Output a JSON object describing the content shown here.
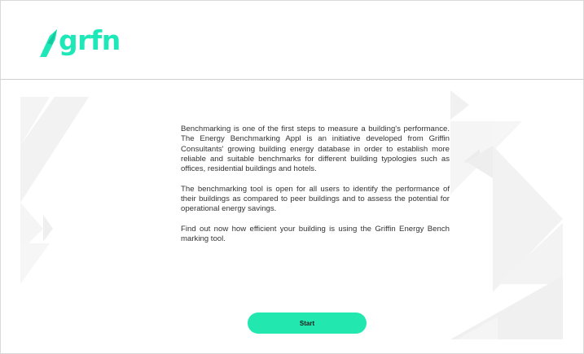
{
  "brand": {
    "logo_text": "grfn",
    "logo_icon": "grfn-arrow-mark",
    "accent_color": "#1ee8b8"
  },
  "intro": {
    "paragraphs": [
      "Benchmarking is one of the first steps to measure a building's performance. The Energy Benchmarking Appl is an initiative developed from Griffin Consultants' growing building energy database in order to establish more reliable and suitable benchmarks for different building typologies such as offices, residential buildings and hotels.",
      "The benchmarking tool is open for all users to identify the performance of their buildings as compared to peer buildings and to assess the potential for operational energy savings.",
      "Find out now how efficient your building is using the Griffin Energy Bench marking tool."
    ]
  },
  "actions": {
    "start_label": "Start",
    "button_color": "#22e8b0"
  },
  "decor": {
    "shape_color": "#f3f3f3"
  }
}
